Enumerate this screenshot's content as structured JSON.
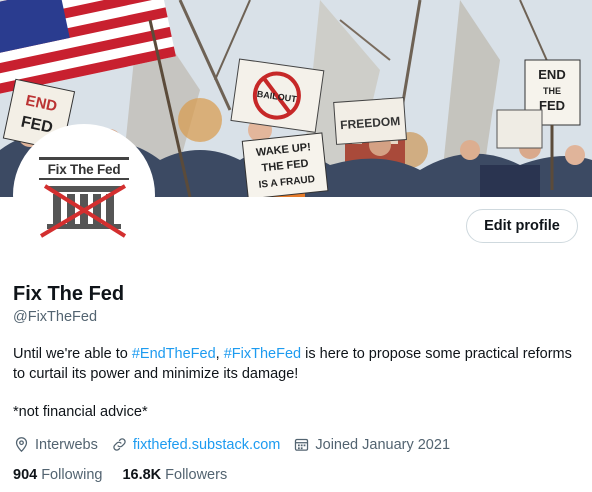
{
  "profile": {
    "name": "Fix The Fed",
    "handle": "@FixTheFed",
    "avatar_text": "Fix The Fed",
    "edit_label": "Edit profile",
    "bio": {
      "part1": "Until we're able to ",
      "tag1": "#EndTheFed",
      "part2": ", ",
      "tag2": "#FixTheFed",
      "part3": " is here to propose some practical reforms to curtail its power and minimize its damage!"
    },
    "note": "*not financial advice*",
    "location": "Interwebs",
    "website": "fixthefed.substack.com",
    "joined": "Joined January 2021",
    "following_count": "904",
    "following_label": "Following",
    "followers_count": "16.8K",
    "followers_label": "Followers"
  },
  "banner": {
    "sign_end_fed": [
      "END",
      "THE",
      "FED"
    ],
    "sign_wake_up": [
      "WAKE UP!",
      "THE FED",
      "IS A FRAUD"
    ],
    "sign_freedom": "FREEDOM",
    "sign_bailout": "BAILOUT"
  },
  "icons": {
    "location": "location-pin-icon",
    "website": "link-icon",
    "joined": "calendar-icon"
  },
  "colors": {
    "accent": "#1d9bf0",
    "secondary_text": "#536471",
    "primary_text": "#0f1419",
    "avatar_x": "#d32f2f"
  }
}
